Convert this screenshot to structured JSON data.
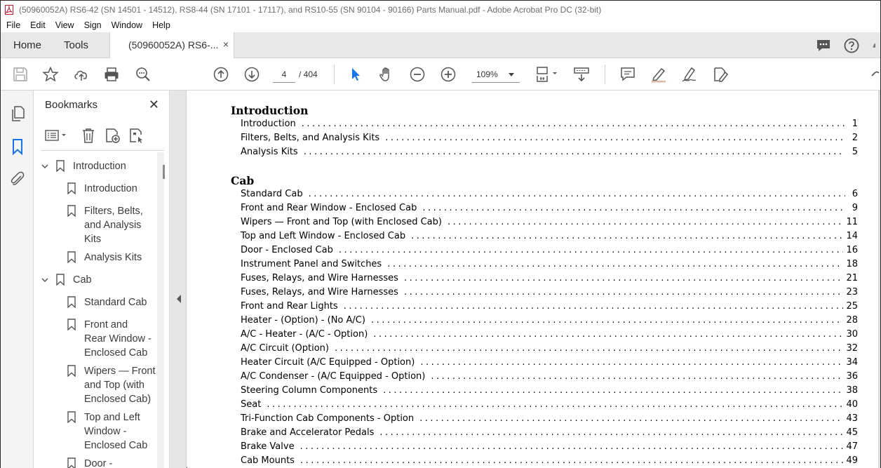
{
  "window": {
    "title": "(50960052A) RS6-42 (SN 14501 - 14512), RS8-44 (SN 17101 - 17117), and RS10-55 (SN 90104 - 90166) Parts Manual.pdf - Adobe Acrobat Pro DC (32-bit)"
  },
  "menu": [
    "File",
    "Edit",
    "View",
    "Sign",
    "Window",
    "Help"
  ],
  "tabs": {
    "home": "Home",
    "tools": "Tools",
    "document": "(50960052A) RS6-...",
    "close": "×"
  },
  "toolbar": {
    "current_page": "4",
    "page_total": "/  404",
    "zoom": "109%"
  },
  "bookmarks": {
    "header": "Bookmarks",
    "close": "✕",
    "items": [
      {
        "label": "Introduction",
        "level": 0,
        "expanded": true
      },
      {
        "label": "Introduction",
        "level": 1
      },
      {
        "label": "Filters, Belts, and Analysis Kits",
        "level": 1
      },
      {
        "label": "Analysis Kits",
        "level": 1
      },
      {
        "label": "Cab",
        "level": 0,
        "expanded": true
      },
      {
        "label": "Standard Cab",
        "level": 1
      },
      {
        "label": "Front and Rear Window - Enclosed Cab",
        "level": 1
      },
      {
        "label": "Wipers — Front and Top (with Enclosed Cab)",
        "level": 1
      },
      {
        "label": "Top and Left Window - Enclosed Cab",
        "level": 1
      },
      {
        "label": "Door -",
        "level": 1
      }
    ]
  },
  "document": {
    "sections": [
      {
        "title": "Introduction",
        "entries": [
          {
            "text": "Introduction",
            "page": "1"
          },
          {
            "text": "Filters, Belts, and Analysis Kits",
            "page": "2"
          },
          {
            "text": "Analysis Kits",
            "page": "5"
          }
        ]
      },
      {
        "title": "Cab",
        "entries": [
          {
            "text": "Standard Cab",
            "page": "6"
          },
          {
            "text": "Front and Rear Window - Enclosed Cab",
            "page": "9"
          },
          {
            "text": "Wipers — Front and Top (with Enclosed Cab)",
            "page": "11"
          },
          {
            "text": "Top and Left Window - Enclosed Cab",
            "page": "14"
          },
          {
            "text": "Door - Enclosed Cab",
            "page": "16"
          },
          {
            "text": "Instrument Panel and Switches",
            "page": "18"
          },
          {
            "text": "Fuses, Relays, and Wire Harnesses",
            "page": "21"
          },
          {
            "text": "Fuses, Relays, and Wire Harnesses",
            "page": "23"
          },
          {
            "text": "Front and Rear Lights",
            "page": "25"
          },
          {
            "text": "Heater - (Option) - (No A/C)",
            "page": "28"
          },
          {
            "text": "A/C - Heater - (A/C - Option)",
            "page": "30"
          },
          {
            "text": "A/C Circuit (Option)",
            "page": "32"
          },
          {
            "text": "Heater Circuit (A/C Equipped - Option)",
            "page": "34"
          },
          {
            "text": "A/C Condenser - (A/C Equipped - Option)",
            "page": "36"
          },
          {
            "text": "Steering Column Components",
            "page": "38"
          },
          {
            "text": "Seat",
            "page": "40"
          },
          {
            "text": "Tri-Function Cab Components - Option",
            "page": "43"
          },
          {
            "text": "Brake and Accelerator Pedals",
            "page": "45"
          },
          {
            "text": "Brake Valve",
            "page": "47"
          },
          {
            "text": "Cab Mounts",
            "page": "49"
          }
        ]
      }
    ]
  }
}
